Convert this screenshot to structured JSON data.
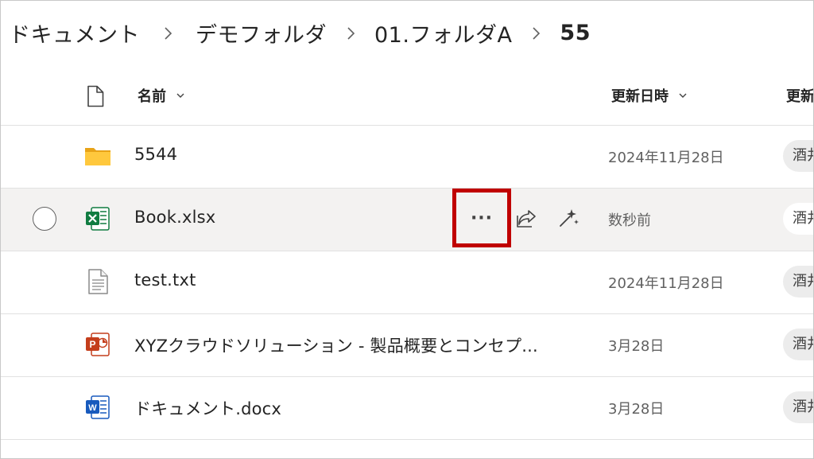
{
  "breadcrumb": {
    "items": [
      "ドキュメント",
      "デモフォルダ",
      "01.フォルダA"
    ],
    "current": "55"
  },
  "columns": {
    "name": "名前",
    "modified": "更新日時",
    "modified_by": "更新"
  },
  "rows": [
    {
      "name": "5544",
      "type": "folder",
      "modified": "2024年11月28日",
      "modified_by": "酒井"
    },
    {
      "name": "Book.xlsx",
      "type": "excel",
      "modified": "数秒前",
      "modified_by": "酒井",
      "more_label": "···"
    },
    {
      "name": "test.txt",
      "type": "text",
      "modified": "2024年11月28日",
      "modified_by": "酒井"
    },
    {
      "name": "XYZクラウドソリューション - 製品概要とコンセプ...",
      "type": "powerpoint",
      "modified": "3月28日",
      "modified_by": "酒井"
    },
    {
      "name": "ドキュメント.docx",
      "type": "word",
      "modified": "3月28日",
      "modified_by": "酒井"
    }
  ],
  "colors": {
    "highlight_box": "#c00000",
    "hover_row": "#f3f2f1",
    "folder": "#f5b82e",
    "excel": "#107c41",
    "powerpoint": "#c43e1c",
    "word": "#185abd"
  },
  "icons": {
    "header_file": "file-icon",
    "share": "share-icon",
    "copilot": "sparkle-icon",
    "chevron": "chevron-down-icon"
  }
}
